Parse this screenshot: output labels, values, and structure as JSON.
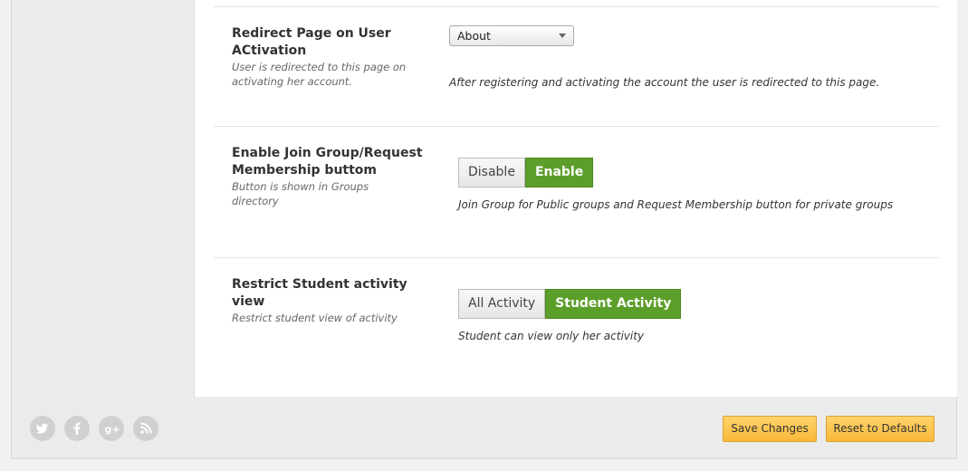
{
  "options": [
    {
      "title": "Redirect Page on User ACtivation",
      "description": "User is redirected to this page on activating her account.",
      "control": {
        "type": "select",
        "value": "About"
      },
      "hint": "After registering and activating the account the user is redirected to this page."
    },
    {
      "title": "Enable Join Group/Request Membership buttom",
      "description": "Button is shown in Groups directory",
      "control": {
        "type": "toggle",
        "options": [
          "Disable",
          "Enable"
        ],
        "selected": "Enable"
      },
      "hint": "Join Group for Public groups and Request Membership button for private groups"
    },
    {
      "title": "Restrict Student activity view",
      "description": "Restrict student view of activity",
      "control": {
        "type": "toggle",
        "options": [
          "All Activity",
          "Student Activity"
        ],
        "selected": "Student Activity"
      },
      "hint": "Student can view only her activity"
    }
  ],
  "footer": {
    "social_icons": [
      "twitter-icon",
      "facebook-icon",
      "google-plus-icon",
      "rss-icon"
    ],
    "save_label": "Save Changes",
    "reset_label": "Reset to Defaults"
  },
  "colors": {
    "toggle_active": "#5c9e2a",
    "action_button": "#f9b93a"
  }
}
